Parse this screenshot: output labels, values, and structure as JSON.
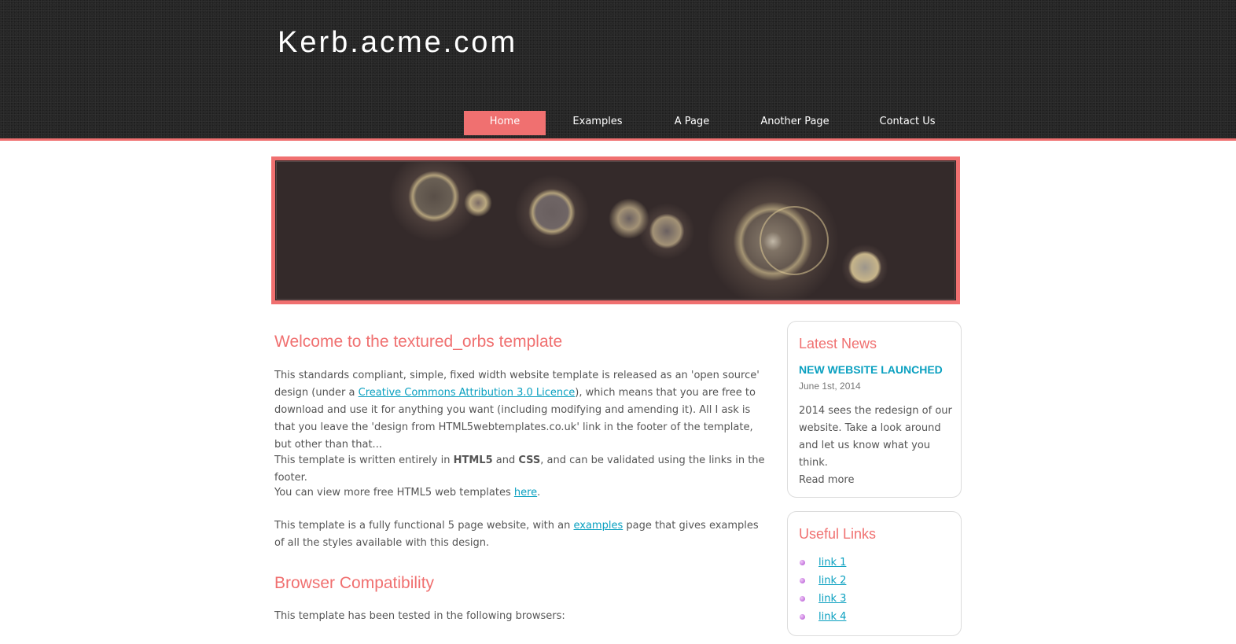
{
  "site": {
    "title": "Kerb.acme.com"
  },
  "nav": {
    "items": [
      {
        "label": "Home",
        "active": true
      },
      {
        "label": "Examples",
        "active": false
      },
      {
        "label": "A Page",
        "active": false
      },
      {
        "label": "Another Page",
        "active": false
      },
      {
        "label": "Contact Us",
        "active": false
      }
    ]
  },
  "colors": {
    "accent": "#f07070",
    "link": "#0aa0c0",
    "header_bg": "#262626",
    "banner_bg": "#342a2a"
  },
  "main": {
    "heading1": "Welcome to the textured_orbs template",
    "p1": {
      "before": "This standards compliant, simple, fixed width website template is released as an 'open source' design (under a ",
      "link": "Creative Commons Attribution 3.0 Licence",
      "after": "), which means that you are free to download and use it for anything you want (including modifying and amending it). All I ask is that you leave the 'design from HTML5webtemplates.co.uk' link in the footer of the template, but other than that..."
    },
    "p2": {
      "before": "This template is written entirely in ",
      "bold1": "HTML5",
      "mid": " and ",
      "bold2": "CSS",
      "after": ", and can be validated using the links in the footer."
    },
    "p3": {
      "before": "You can view more free HTML5 web templates ",
      "link": "here",
      "after": "."
    },
    "p4": {
      "before": "This template is a fully functional 5 page website, with an ",
      "link": "examples",
      "after": " page that gives examples of all the styles available with this design."
    },
    "heading2": "Browser Compatibility",
    "p5": "This template has been tested in the following browsers:"
  },
  "sidebar": {
    "news": {
      "heading": "Latest News",
      "title": "NEW WEBSITE LAUNCHED",
      "date": "June 1st, 2014",
      "body": "2014 sees the redesign of our website. Take a look around and let us know what you think.",
      "read_more": "Read more"
    },
    "links": {
      "heading": "Useful Links",
      "items": [
        "link 1",
        "link 2",
        "link 3",
        "link 4"
      ]
    }
  }
}
